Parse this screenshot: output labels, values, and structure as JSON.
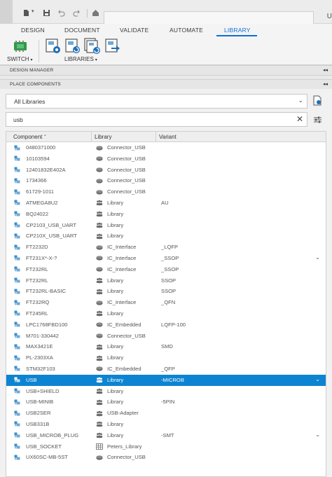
{
  "ribbon": {
    "tabs": [
      "DESIGN",
      "DOCUMENT",
      "VALIDATE",
      "AUTOMATE",
      "LIBRARY"
    ],
    "active_tab": "LIBRARY",
    "switch_label": "SWITCH",
    "libraries_label": "LIBRARIES"
  },
  "title_bar": {
    "right_fragment": "U"
  },
  "sections": {
    "design_manager": "DESIGN MANAGER",
    "place_components": "PLACE COMPONENTS"
  },
  "library_filter": {
    "selected": "All Libraries"
  },
  "search": {
    "value": "usb"
  },
  "table": {
    "columns": {
      "component": "Component",
      "library": "Library",
      "variant": "Variant"
    },
    "rows": [
      {
        "component": "0480371000",
        "library": "Connector_USB",
        "variant": "",
        "lib_icon": "chip-icon"
      },
      {
        "component": "10103594",
        "library": "Connector_USB",
        "variant": "",
        "lib_icon": "chip-icon"
      },
      {
        "component": "12401832E402A",
        "library": "Connector_USB",
        "variant": "",
        "lib_icon": "chip-icon"
      },
      {
        "component": "1734366",
        "library": "Connector_USB",
        "variant": "",
        "lib_icon": "chip-icon"
      },
      {
        "component": "61729-1011",
        "library": "Connector_USB",
        "variant": "",
        "lib_icon": "chip-icon"
      },
      {
        "component": "ATMEGA8U2",
        "library": "Library",
        "variant": "AU",
        "lib_icon": "users-icon"
      },
      {
        "component": "BQ24022",
        "library": "Library",
        "variant": "",
        "lib_icon": "users-icon"
      },
      {
        "component": "CP2103_USB_UART",
        "library": "Library",
        "variant": "",
        "lib_icon": "users-icon"
      },
      {
        "component": "CP210X_USB_UART",
        "library": "Library",
        "variant": "",
        "lib_icon": "users-icon"
      },
      {
        "component": "FT2232D",
        "library": "IC_Interface",
        "variant": "_LQFP",
        "lib_icon": "chip-icon"
      },
      {
        "component": "FT231X*-X-?",
        "library": "IC_Interface",
        "variant": "_SSOP",
        "lib_icon": "chip-icon",
        "expand": true
      },
      {
        "component": "FT232RL",
        "library": "IC_Interface",
        "variant": "_SSOP",
        "lib_icon": "chip-icon"
      },
      {
        "component": "FT232RL",
        "library": "Library",
        "variant": "SSOP",
        "lib_icon": "users-icon"
      },
      {
        "component": "FT232RL-BASIC",
        "library": "Library",
        "variant": "SSOP",
        "lib_icon": "users-icon"
      },
      {
        "component": "FT232RQ",
        "library": "IC_Interface",
        "variant": "_QFN",
        "lib_icon": "chip-icon"
      },
      {
        "component": "FT245RL",
        "library": "Library",
        "variant": "",
        "lib_icon": "users-icon"
      },
      {
        "component": "LPC1768FBD100",
        "library": "IC_Embedded",
        "variant": "LQFP-100",
        "lib_icon": "chip-icon"
      },
      {
        "component": "M701-330442",
        "library": "Connector_USB",
        "variant": "",
        "lib_icon": "chip-icon"
      },
      {
        "component": "MAX3421E",
        "library": "Library",
        "variant": "SMD",
        "lib_icon": "users-icon"
      },
      {
        "component": "PL-2303XA",
        "library": "Library",
        "variant": "",
        "lib_icon": "users-icon"
      },
      {
        "component": "STM32F103",
        "library": "IC_Embedded",
        "variant": "_QFP",
        "lib_icon": "chip-icon"
      },
      {
        "component": "USB",
        "library": "Library",
        "variant": "-MICROB",
        "lib_icon": "users-icon",
        "expand": true,
        "selected": true
      },
      {
        "component": "USB+SHIELD",
        "library": "Library",
        "variant": "",
        "lib_icon": "users-icon"
      },
      {
        "component": "USB-MINIB",
        "library": "Library",
        "variant": "-5PIN",
        "lib_icon": "users-icon"
      },
      {
        "component": "USB2SER",
        "library": "USB-Adapter",
        "variant": "",
        "lib_icon": "users-icon"
      },
      {
        "component": "USB331B",
        "library": "Library",
        "variant": "",
        "lib_icon": "users-icon"
      },
      {
        "component": "USB_MICROB_PLUG",
        "library": "Library",
        "variant": "-SMT",
        "lib_icon": "users-icon",
        "expand": true
      },
      {
        "component": "USB_SOCKET",
        "library": "Peters_Library",
        "variant": "",
        "lib_icon": "grid-icon"
      },
      {
        "component": "UX60SC-MB-5ST",
        "library": "Connector_USB",
        "variant": "",
        "lib_icon": "chip-icon"
      }
    ]
  },
  "colors": {
    "accent": "#0f6fd6",
    "selection": "#0d84d1",
    "component_icon": "#3d8ec9",
    "switch_icon": "#2e9a47"
  }
}
